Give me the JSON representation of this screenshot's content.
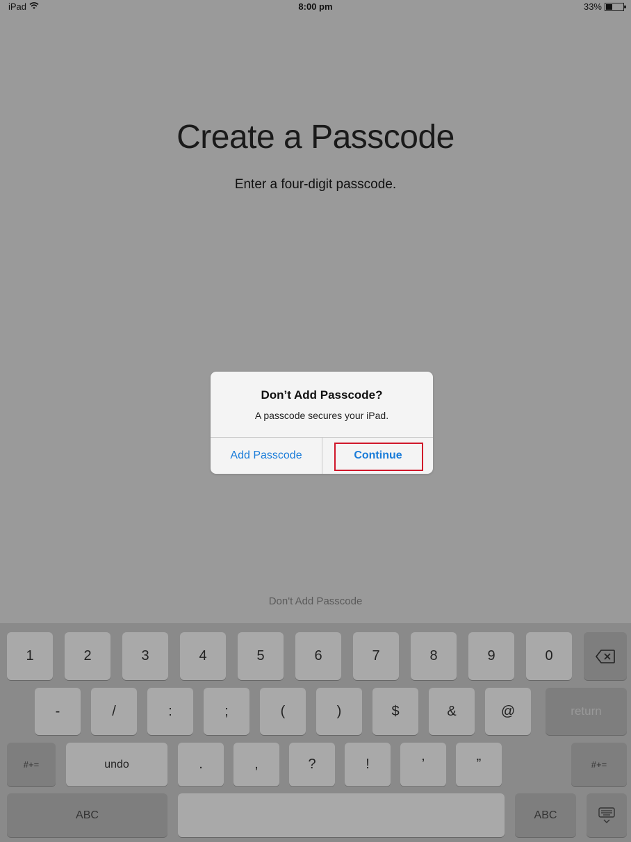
{
  "status_bar": {
    "device": "iPad",
    "time": "8:00 pm",
    "battery_percent": "33%",
    "battery_level": 0.33
  },
  "screen": {
    "title": "Create a Passcode",
    "subtitle": "Enter a four-digit passcode.",
    "skip_link": "Don't Add Passcode"
  },
  "alert": {
    "title": "Don’t Add Passcode?",
    "message": "A passcode secures your iPad.",
    "cancel_label": "Add Passcode",
    "confirm_label": "Continue",
    "highlight_color": "#d0172a",
    "button_color": "#1a7cd9"
  },
  "keyboard": {
    "row1": [
      "1",
      "2",
      "3",
      "4",
      "5",
      "6",
      "7",
      "8",
      "9",
      "0"
    ],
    "row2": [
      "-",
      "/",
      ":",
      ";",
      "(",
      ")",
      "$",
      "&",
      "@"
    ],
    "row3": [
      ".",
      ",",
      "?",
      "!",
      "’",
      "”"
    ],
    "return_label": "return",
    "symbols_label": "#+=",
    "undo_label": "undo",
    "abc_label": "ABC",
    "backspace_icon": "backspace-icon",
    "dismiss_icon": "keyboard-dismiss-icon"
  }
}
